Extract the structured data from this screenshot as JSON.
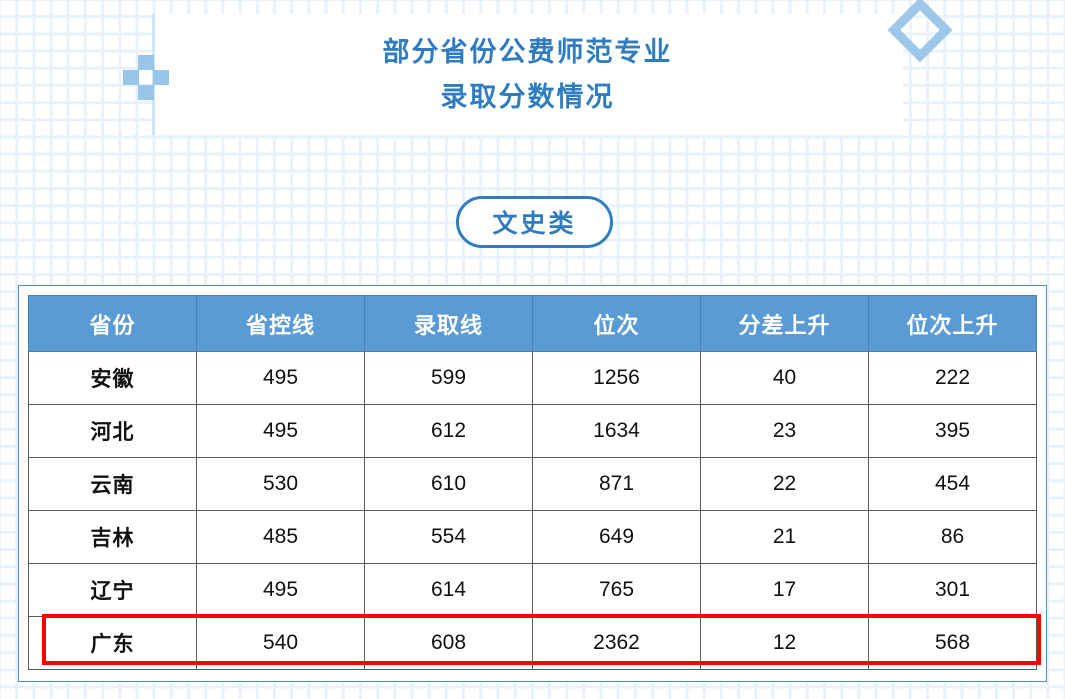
{
  "background": {
    "grid_color": "#e9f2fb",
    "page_bg": "#ffffff"
  },
  "header": {
    "title_line_1": "部分省份公费师范专业",
    "title_line_2": "录取分数情况",
    "title_color": "#2f7dc0"
  },
  "decorations": {
    "plus_icon_color": "#98c6ea",
    "diamond_icon_color": "#9ec8ea"
  },
  "category": {
    "label": "文史类",
    "border_color": "#2f7dc0"
  },
  "table": {
    "header_bg": "#5b9bd5",
    "header_text_color": "#ffffff",
    "border_color": "#5a5a5a",
    "frame_border_color": "#4a90c4",
    "highlight_color": "#ff0000",
    "columns": [
      "省份",
      "省控线",
      "录取线",
      "位次",
      "分差上升",
      "位次上升"
    ],
    "rows": [
      {
        "province": "安徽",
        "provincial_line": "495",
        "admission_line": "599",
        "rank": "1256",
        "score_gap_rise": "40",
        "rank_rise": "222",
        "highlighted": false
      },
      {
        "province": "河北",
        "provincial_line": "495",
        "admission_line": "612",
        "rank": "1634",
        "score_gap_rise": "23",
        "rank_rise": "395",
        "highlighted": false
      },
      {
        "province": "云南",
        "provincial_line": "530",
        "admission_line": "610",
        "rank": "871",
        "score_gap_rise": "22",
        "rank_rise": "454",
        "highlighted": false
      },
      {
        "province": "吉林",
        "provincial_line": "485",
        "admission_line": "554",
        "rank": "649",
        "score_gap_rise": "21",
        "rank_rise": "86",
        "highlighted": false
      },
      {
        "province": "辽宁",
        "provincial_line": "495",
        "admission_line": "614",
        "rank": "765",
        "score_gap_rise": "17",
        "rank_rise": "301",
        "highlighted": false
      },
      {
        "province": "广东",
        "provincial_line": "540",
        "admission_line": "608",
        "rank": "2362",
        "score_gap_rise": "12",
        "rank_rise": "568",
        "highlighted": true
      }
    ]
  },
  "chart_data": {
    "type": "table",
    "title": "部分省份公费师范专业 录取分数情况",
    "subtitle": "文史类",
    "columns": [
      "省份",
      "省控线",
      "录取线",
      "位次",
      "分差上升",
      "位次上升"
    ],
    "rows": [
      [
        "安徽",
        495,
        599,
        1256,
        40,
        222
      ],
      [
        "河北",
        495,
        612,
        1634,
        23,
        395
      ],
      [
        "云南",
        530,
        610,
        871,
        22,
        454
      ],
      [
        "吉林",
        485,
        554,
        649,
        21,
        86
      ],
      [
        "辽宁",
        495,
        614,
        765,
        17,
        301
      ],
      [
        "广东",
        540,
        608,
        2362,
        12,
        568
      ]
    ],
    "highlighted_rows": [
      "广东"
    ]
  }
}
